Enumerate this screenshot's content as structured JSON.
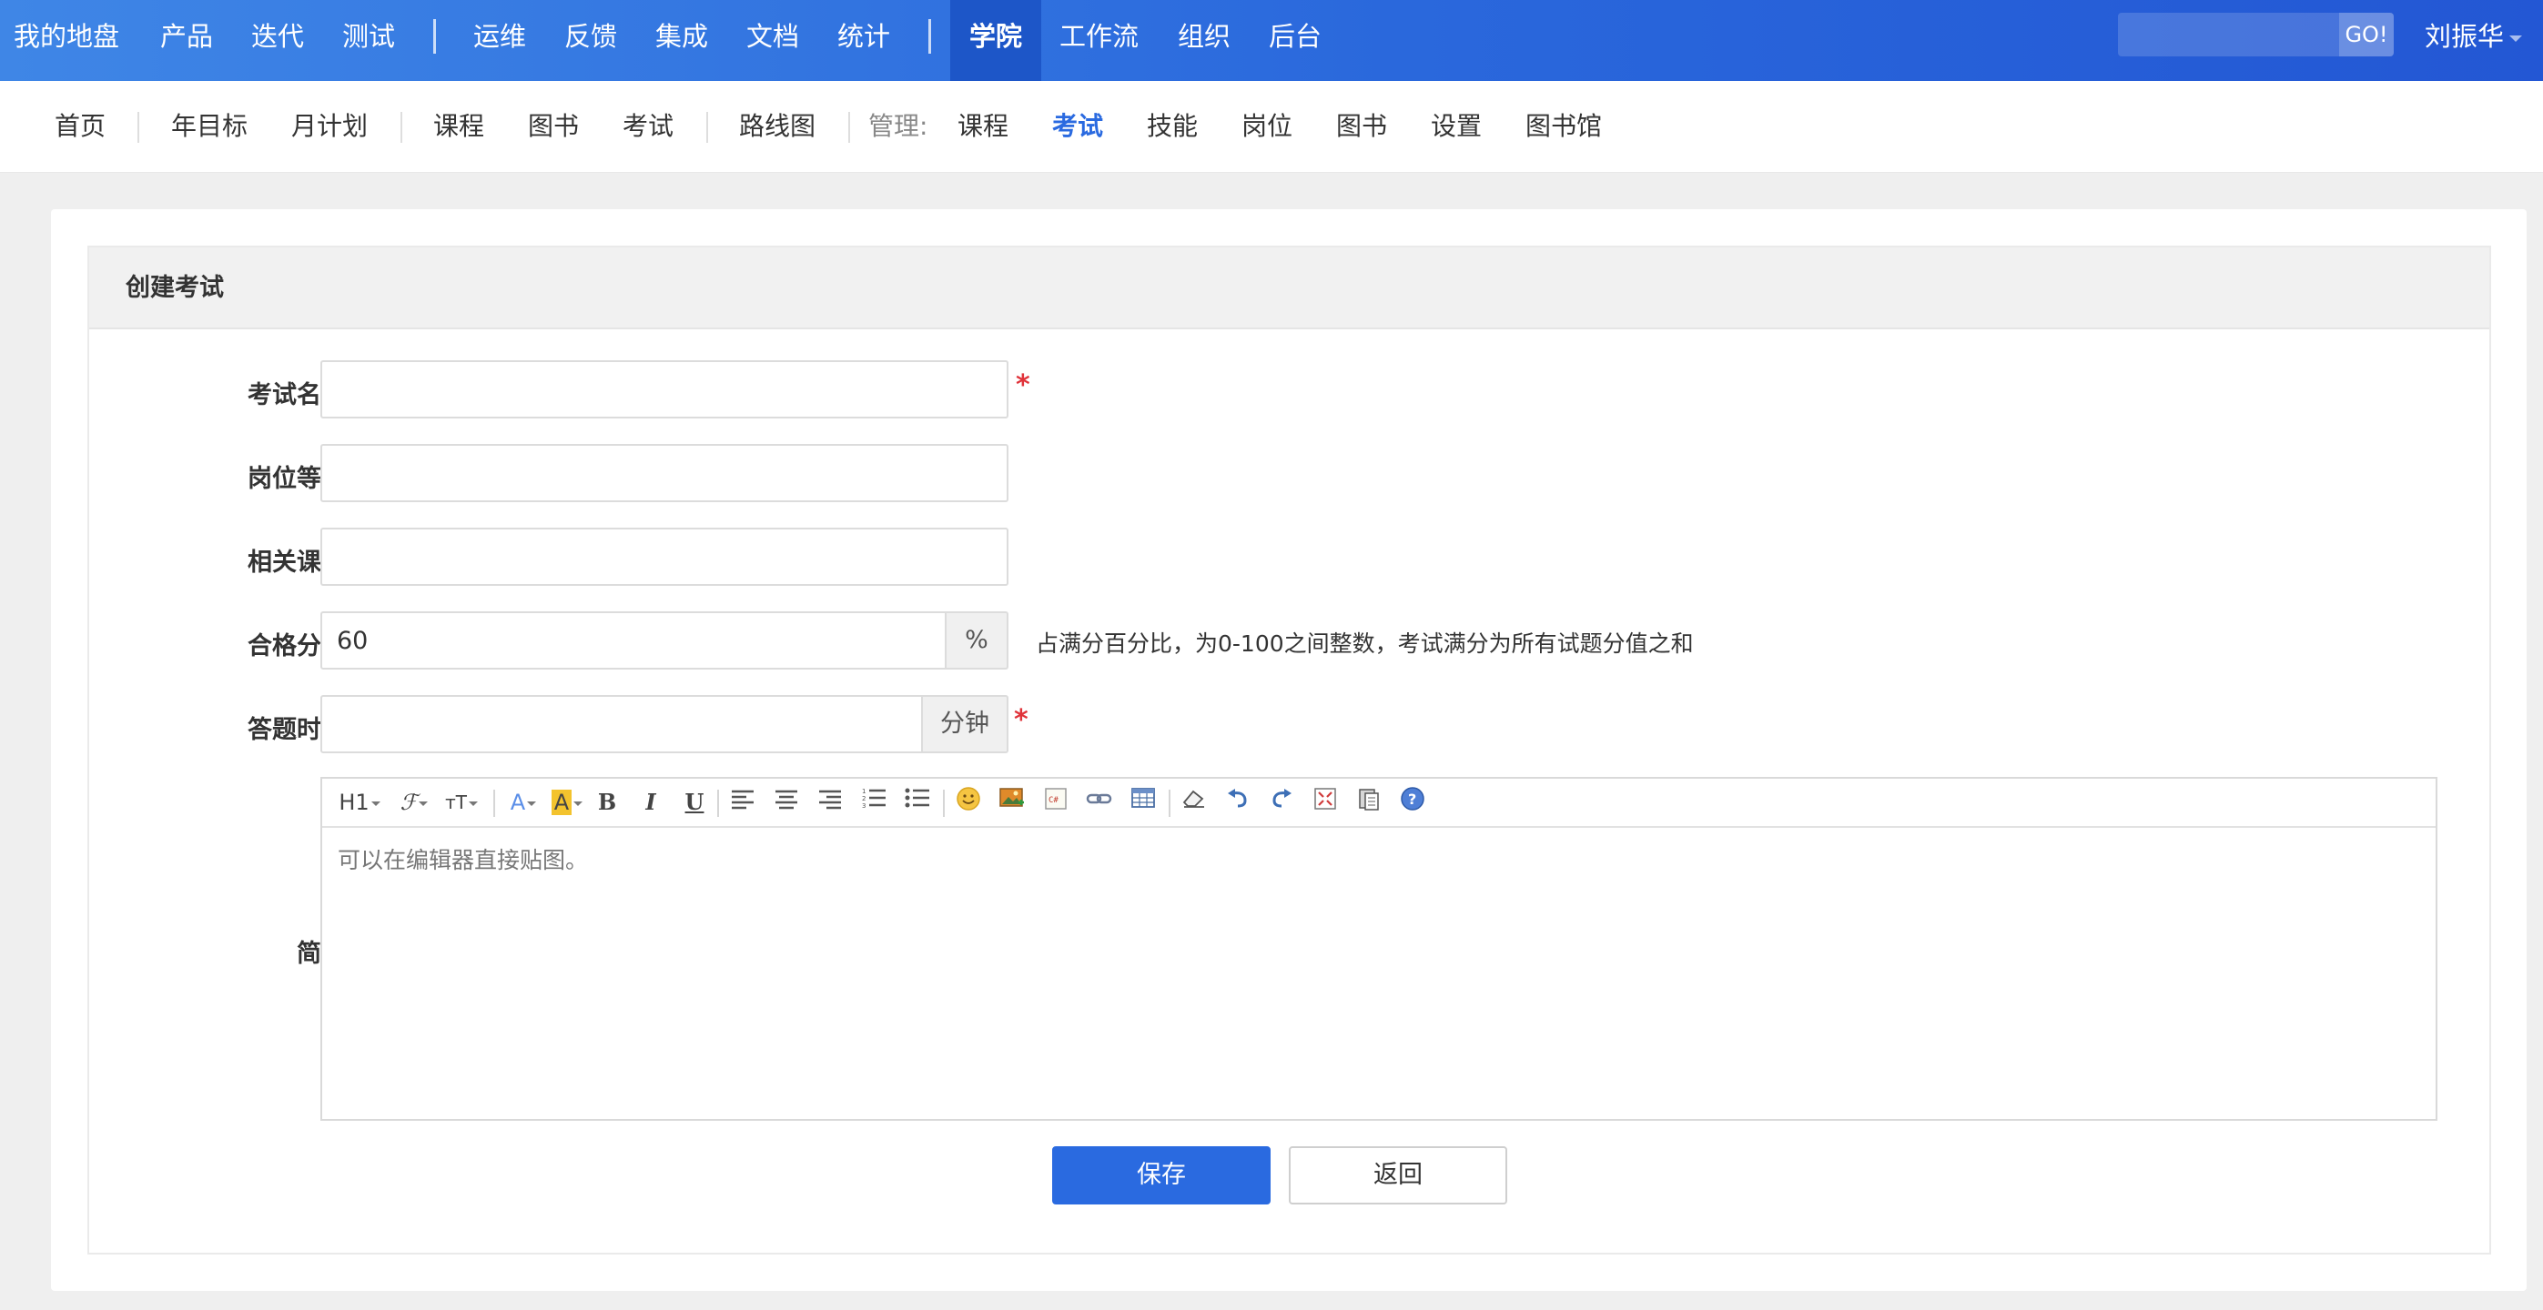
{
  "topnav": {
    "items": [
      "我的地盘",
      "产品",
      "迭代",
      "测试",
      "运维",
      "反馈",
      "集成",
      "文档",
      "统计",
      "学院",
      "工作流",
      "组织",
      "后台"
    ],
    "active": "学院",
    "search_placeholder": "",
    "search_button": "GO!",
    "user": "刘振华",
    "colors": {
      "bar": "#2a68dc",
      "active": "#1d56c8"
    }
  },
  "subnav": {
    "items": [
      "首页",
      "年目标",
      "月计划",
      "课程",
      "图书",
      "考试",
      "路线图"
    ],
    "manage_label": "管理:",
    "manage_items": [
      "课程",
      "考试",
      "技能",
      "岗位",
      "图书",
      "设置",
      "图书馆"
    ],
    "active": "考试"
  },
  "panel": {
    "title": "创建考试"
  },
  "form": {
    "name_label": "考试名称",
    "name_value": "",
    "level_label": "岗位等级",
    "level_value": "",
    "course_label": "相关课程",
    "course_value": "",
    "pass_label": "合格分数",
    "pass_value": "60",
    "pass_unit": "%",
    "pass_help": "占满分百分比，为0-100之间整数，考试满分为所有试题分值之和",
    "time_label": "答题时间",
    "time_value": "",
    "time_unit": "分钟",
    "required_mark": "*",
    "intro_label": "简介",
    "intro_placeholder": "可以在编辑器直接贴图。"
  },
  "editor_toolbar": {
    "heading": "H1",
    "font_family": "ℱ",
    "font_size": "тT",
    "font_color": "A",
    "bg_color": "A",
    "bold": "B",
    "italic": "I",
    "underline": "U",
    "icons": [
      "align-left-icon",
      "align-center-icon",
      "align-right-icon",
      "ordered-list-icon",
      "unordered-list-icon",
      "emoji-icon",
      "image-icon",
      "code-icon",
      "link-icon",
      "table-icon",
      "eraser-icon",
      "undo-icon",
      "redo-icon",
      "fullscreen-icon",
      "paste-icon",
      "help-icon"
    ]
  },
  "actions": {
    "save": "保存",
    "back": "返回"
  }
}
